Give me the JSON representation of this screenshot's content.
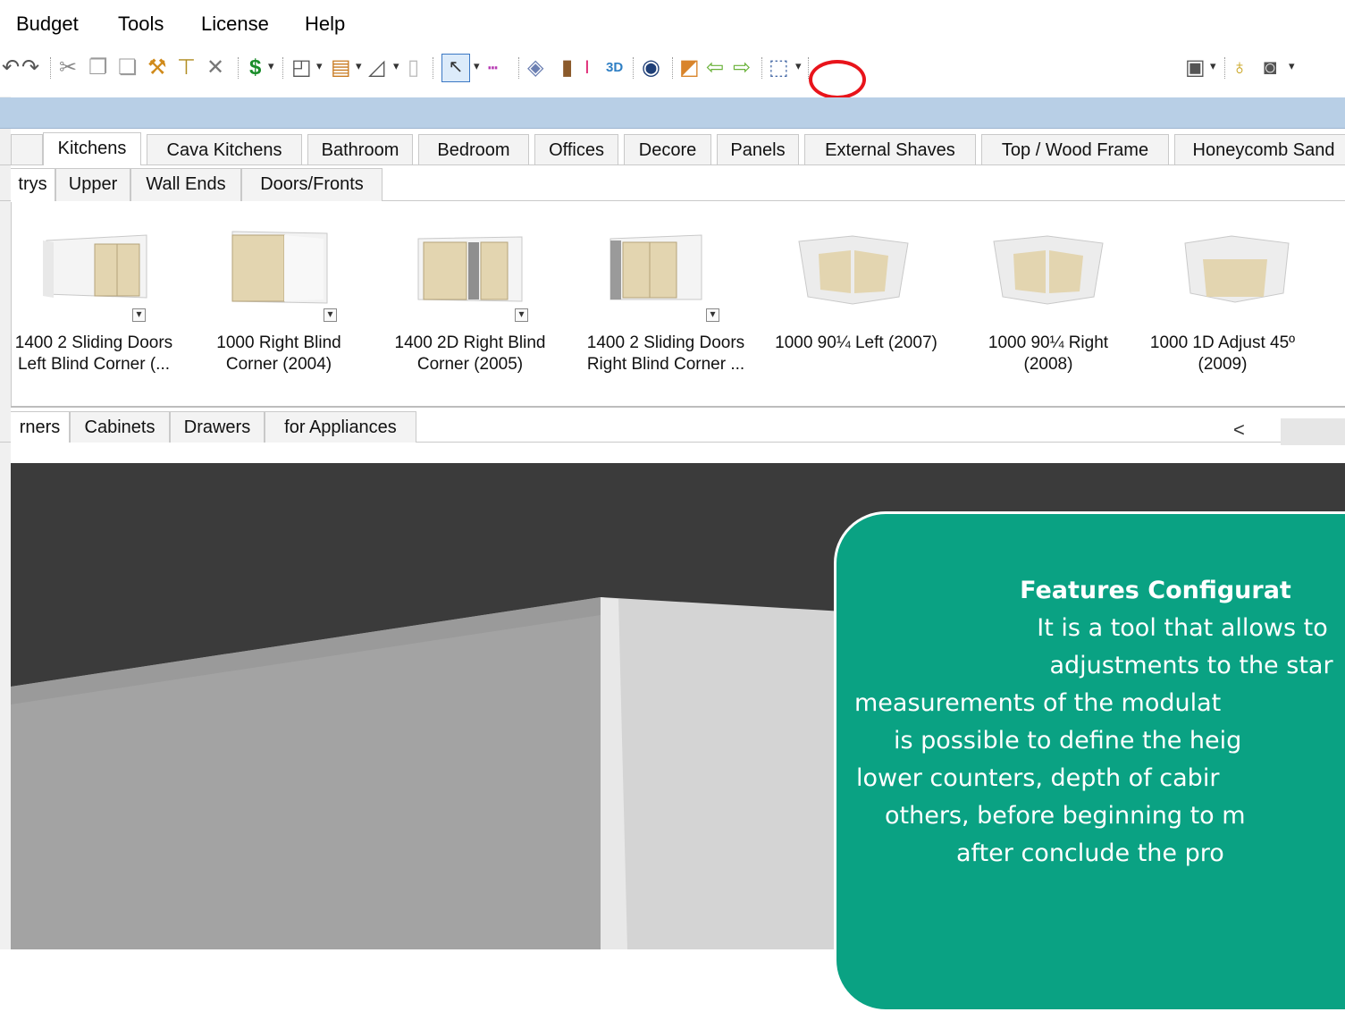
{
  "menu": [
    "Budget",
    "Tools",
    "License",
    "Help"
  ],
  "toolbar": {
    "icons": [
      "redo-icon",
      "cut-icon",
      "copy-icon",
      "paste-icon",
      "hammer-icon",
      "paint-roller-icon",
      "delete-icon",
      "budget-dollar-icon",
      "floor-plan-icon",
      "wall-icon",
      "shape-icon",
      "column-icon",
      "select-pointer-icon",
      "dimension-icon",
      "layers-icon",
      "features-configuration-icon",
      "3d-view-icon",
      "eye-icon",
      "render-icon",
      "arrow-left-icon",
      "arrow-right-icon",
      "box-view-icon",
      "cube-icon",
      "light-icon",
      "camera-icon"
    ]
  },
  "main_tabs": [
    "Kitchens",
    "Cava Kitchens",
    "Bathroom",
    "Bedroom",
    "Offices",
    "Decore",
    "Panels",
    "External Shaves",
    "Top / Wood Frame",
    "Honeycomb Sand"
  ],
  "sub_tabs": [
    "trys",
    "Upper",
    "Wall Ends",
    "Doors/Fronts"
  ],
  "items": [
    {
      "line1": "1400 2 Sliding Doors",
      "line2": "Left Blind Corner (..."
    },
    {
      "line1": "1000 Right Blind",
      "line2": "Corner (2004)"
    },
    {
      "line1": "1400 2D Right Blind",
      "line2": "Corner (2005)"
    },
    {
      "line1": "1400 2 Sliding Doors",
      "line2": "Right Blind Corner ..."
    },
    {
      "line1": "1000 90¼ Left (2007)",
      "line2": ""
    },
    {
      "line1": "1000 90¼ Right",
      "line2": "(2008)"
    },
    {
      "line1": "1000 1D Adjust 45º",
      "line2": "(2009)"
    }
  ],
  "bottom_tabs": [
    "rners",
    "Cabinets",
    "Drawers",
    "for Appliances"
  ],
  "callout": {
    "title": "Features Configurat",
    "lines": [
      "It is a tool that allows to",
      "adjustments to the star",
      "measurements of the modulat",
      "is possible to define the heig",
      "lower counters, depth of cabir",
      "others, before beginning to m",
      "after conclude the pro"
    ]
  },
  "scroll": {
    "left_arrow": "<"
  }
}
